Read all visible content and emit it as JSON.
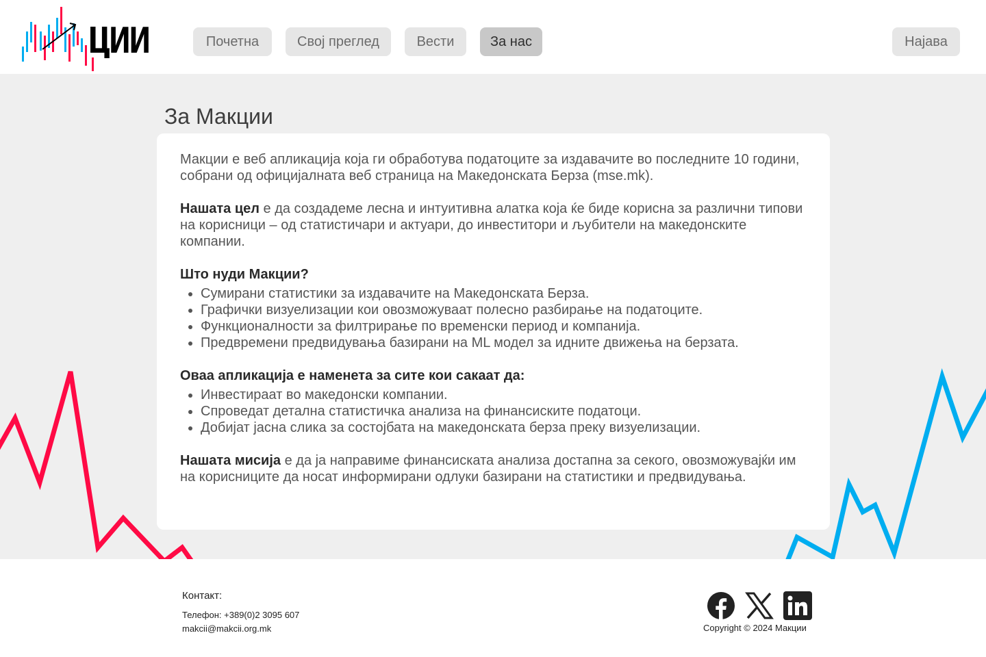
{
  "header": {
    "logo_text": "ЦИИ",
    "nav": [
      {
        "label": "Почетна"
      },
      {
        "label": "Свој преглед"
      },
      {
        "label": "Вести"
      },
      {
        "label": "За нас"
      }
    ],
    "login_label": "Најава"
  },
  "main": {
    "title": "За Макции",
    "intro": "Макции е веб апликација која ги обработува податоците за издавачите во последните 10 години, собрани од официјалната веб страница на Македонската Берза (mse.mk).",
    "goal_bold": "Нашата цел",
    "goal_text": " е да создадеме лесна и интуитивна алатка која ќе биде корисна за различни типови на корисници – од статистичари и актуари, до инвеститори и љубители на македонските компании.",
    "offers_heading": "Што нуди Макции?",
    "offers": [
      "Сумирани статистики за издавачите на Македонската Берза.",
      "Графички визуелизации кои овозможуваат полесно разбирање на податоците.",
      "Функционалности за филтрирање по временски период и компанија.",
      "Предвремени предвидувања базирани на ML модел за идните движења на берзата."
    ],
    "audience_heading": "Оваа апликација е наменета за сите кои сакаат да:",
    "audience": [
      "Инвестираат во македонски компании.",
      "Спроведат детална статистичка анализа на финансиските податоци.",
      "Добијат јасна слика за состојбата на македонската берза преку визуелизации."
    ],
    "mission_bold": "Нашата мисија",
    "mission_text": " е да ја направиме финансиската анализа достапна за секого, овозможувајќи им на корисниците да носат информирани одлуки базирани на статистики и предвидувања."
  },
  "footer": {
    "contact_title": "Контакт:",
    "phone": "Телефон: +389(0)2 3095 607",
    "email": "makcii@makcii.org.mk",
    "copyright": "Copyright © 2024 Макции",
    "social_icons": [
      "facebook-icon",
      "x-icon",
      "linkedin-icon"
    ]
  },
  "colors": {
    "accent_red": "#ff0a45",
    "accent_blue": "#00adf0",
    "active_nav": "#c8c8c8",
    "nav_bg": "#e6e6e6",
    "main_bg": "#efefef"
  }
}
